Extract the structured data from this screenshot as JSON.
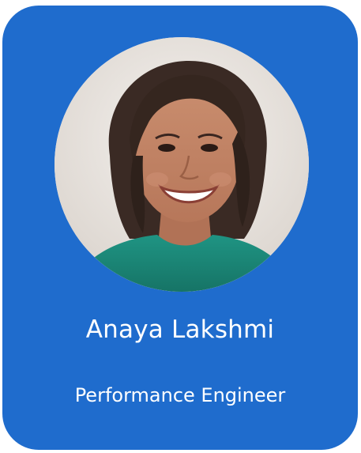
{
  "profile_card": {
    "name": "Anaya Lakshmi",
    "job_title": "Performance Engineer",
    "photo": "person-photo"
  },
  "colors": {
    "card_background": "#1f6ccd",
    "text": "#ffffff",
    "shirt": "#1b8a7a",
    "hair": "#3a2a24"
  }
}
